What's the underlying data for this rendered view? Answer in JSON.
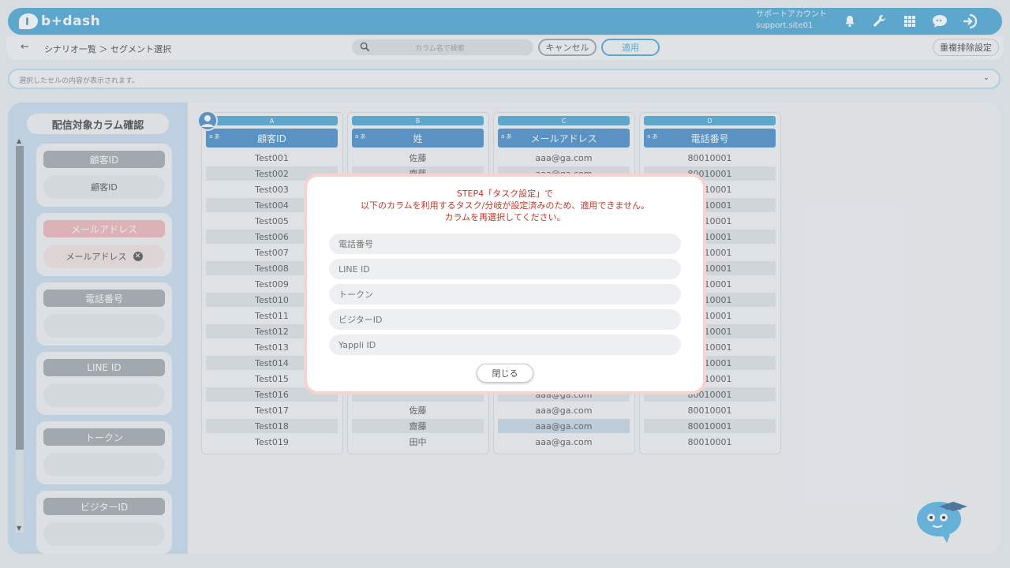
{
  "header": {
    "logo_text": "b+dash",
    "account_label": "サポートアカウント",
    "account_id": "support.site01",
    "icons": [
      "bell-icon",
      "wrench-icon",
      "grid-icon",
      "chat-icon",
      "logout-icon"
    ]
  },
  "toolbar": {
    "back_label": "←",
    "breadcrumb": "シナリオ一覧 ＞ セグメント選択",
    "search_placeholder": "カラム名で検索",
    "cancel_label": "キャンセル",
    "apply_label": "適用",
    "dedupe_label": "重複排除設定"
  },
  "cellbar": {
    "text": "選択したセルの内容が表示されます。"
  },
  "left_panel": {
    "title": "配信対象カラム確認",
    "cards": [
      {
        "head": "顧客ID",
        "body": "顧客ID",
        "state": "normal"
      },
      {
        "head": "メールアドレス",
        "body": "メールアドレス",
        "state": "error"
      },
      {
        "head": "電話番号",
        "body": "",
        "state": "normal"
      },
      {
        "head": "LINE ID",
        "body": "",
        "state": "normal"
      },
      {
        "head": "トークン",
        "body": "",
        "state": "normal"
      },
      {
        "head": "ビジターID",
        "body": "",
        "state": "normal"
      }
    ]
  },
  "columns": [
    {
      "letter": "A",
      "type": "a あ",
      "name": "顧客ID",
      "cells": [
        "Test001",
        "Test002",
        "Test003",
        "Test004",
        "Test005",
        "Test006",
        "Test007",
        "Test008",
        "Test009",
        "Test010",
        "Test011",
        "Test012",
        "Test013",
        "Test014",
        "Test015",
        "Test016",
        "Test017",
        "Test018",
        "Test019"
      ]
    },
    {
      "letter": "B",
      "type": "a あ",
      "name": "姓",
      "cells": [
        "佐藤",
        "齋藤",
        "",
        "",
        "",
        "",
        "",
        "",
        "",
        "",
        "",
        "",
        "",
        "",
        "",
        "",
        "佐藤",
        "齋藤",
        "田中"
      ]
    },
    {
      "letter": "C",
      "type": "a あ",
      "name": "メールアドレス",
      "cells": [
        "aaa@ga.com",
        "aaa@ga.com",
        "",
        "",
        "",
        "",
        "",
        "",
        "",
        "",
        "",
        "",
        "",
        "",
        "",
        "aaa@ga.com",
        "aaa@ga.com",
        "aaa@ga.com",
        "aaa@ga.com"
      ]
    },
    {
      "letter": "D",
      "type": "a あ",
      "name": "電話番号",
      "cells": [
        "80010001",
        "80010001",
        "80010001",
        "80010001",
        "80010001",
        "80010001",
        "80010001",
        "80010001",
        "80010001",
        "80010001",
        "80010001",
        "80010001",
        "80010001",
        "80010001",
        "80010001",
        "80010001",
        "80010001",
        "80010001",
        "80010001"
      ]
    }
  ],
  "modal": {
    "line1": "STEP4「タスク設定」で",
    "line2": "以下のカラムを利用するタスク/分岐が設定済みのため、適用できません。",
    "line3": "カラムを再選択してください。",
    "items": [
      "電話番号",
      "LINE ID",
      "トークン",
      "ビジターID",
      "Yappli ID"
    ],
    "close_label": "閉じる"
  },
  "colors": {
    "brand": "#4ea9d9",
    "column_header": "#4a90cc",
    "error_text": "#c0392b",
    "error_border": "#f5d3d3"
  }
}
